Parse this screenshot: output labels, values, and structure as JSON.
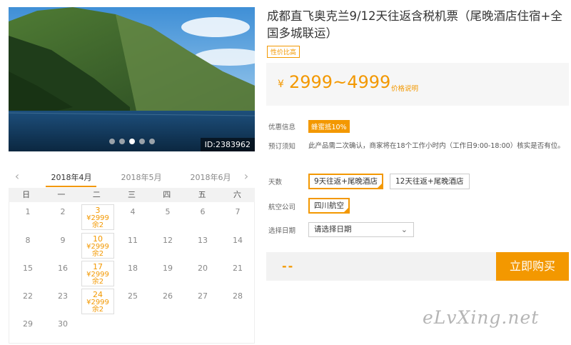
{
  "photo": {
    "id_label": "ID:2383962",
    "dots": [
      false,
      false,
      true,
      false,
      false
    ]
  },
  "calendar": {
    "months": [
      "2018年4月",
      "2018年5月",
      "2018年6月"
    ],
    "active_month_index": 0,
    "weekdays": [
      "日",
      "一",
      "二",
      "三",
      "四",
      "五",
      "六"
    ],
    "rows": [
      [
        {
          "day": "1"
        },
        {
          "day": "2"
        },
        {
          "day": "3",
          "price": "¥2999",
          "remain": "余2"
        },
        {
          "day": "4"
        },
        {
          "day": "5"
        },
        {
          "day": "6"
        },
        {
          "day": "7"
        }
      ],
      [
        {
          "day": "8"
        },
        {
          "day": "9"
        },
        {
          "day": "10",
          "price": "¥2999",
          "remain": "余2"
        },
        {
          "day": "11"
        },
        {
          "day": "12"
        },
        {
          "day": "13"
        },
        {
          "day": "14"
        }
      ],
      [
        {
          "day": "15"
        },
        {
          "day": "16"
        },
        {
          "day": "17",
          "price": "¥2999",
          "remain": "余2"
        },
        {
          "day": "18"
        },
        {
          "day": "19"
        },
        {
          "day": "20"
        },
        {
          "day": "21"
        }
      ],
      [
        {
          "day": "22"
        },
        {
          "day": "23"
        },
        {
          "day": "24",
          "price": "¥2999",
          "remain": "余2"
        },
        {
          "day": "25"
        },
        {
          "day": "26"
        },
        {
          "day": "27"
        },
        {
          "day": "28"
        }
      ],
      [
        {
          "day": "29"
        },
        {
          "day": "30"
        }
      ]
    ]
  },
  "product": {
    "title": "成都直飞奥克兰9/12天往返含税机票（尾晚酒店住宿+全国多城联运）",
    "tag": "性价比高",
    "price_symbol": "¥",
    "price_range": "2999~4999",
    "price_note": "价格说明"
  },
  "info": {
    "promo_label": "优惠信息",
    "promo_badge": "蜂蜜抵10%",
    "notice_label": "预订须知",
    "notice_text": "此产品需二次确认，商家将在18个工作小时内（工作日9:00-18:00）核实是否有位。"
  },
  "options": {
    "days_label": "天数",
    "days": [
      {
        "label": "9天往返+尾晚酒店",
        "selected": true
      },
      {
        "label": "12天往返+尾晚酒店",
        "selected": false
      }
    ],
    "airline_label": "航空公司",
    "airlines": [
      {
        "label": "四川航空",
        "selected": true
      }
    ],
    "date_label": "选择日期",
    "date_placeholder": "请选择日期"
  },
  "purchase": {
    "total": "--",
    "buy_label": "立即购买"
  },
  "watermark": "eLvXing.net",
  "colors": {
    "accent": "#f39800"
  }
}
